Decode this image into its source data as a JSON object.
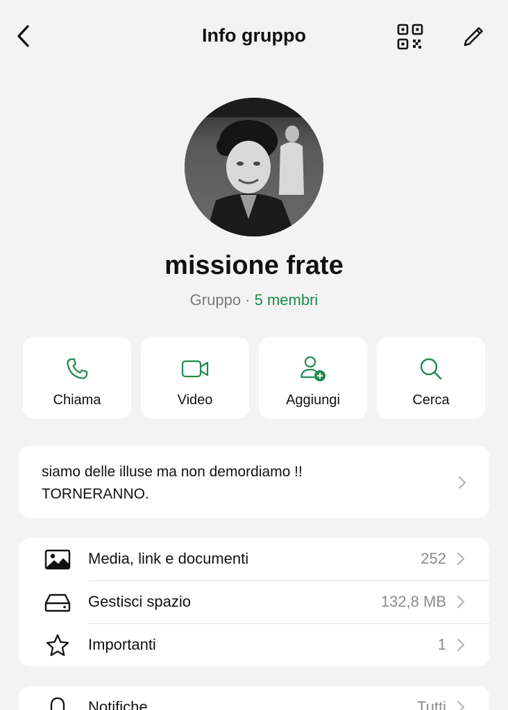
{
  "status": {
    "fragment": "‹ Indietro"
  },
  "header": {
    "title": "Info gruppo"
  },
  "group": {
    "name": "missione frate",
    "type_label": "Gruppo",
    "separator": " · ",
    "members_label": "5 membri"
  },
  "actions": [
    {
      "label": "Chiama",
      "icon": "phone-icon"
    },
    {
      "label": "Video",
      "icon": "video-camera-icon"
    },
    {
      "label": "Aggiungi",
      "icon": "add-person-icon"
    },
    {
      "label": "Cerca",
      "icon": "search-icon"
    }
  ],
  "description": {
    "line1": "siamo delle illuse ma non demordiamo !!",
    "line2": "TORNERANNO."
  },
  "list": [
    {
      "label": "Media, link e documenti",
      "value": "252",
      "icon": "photo-icon"
    },
    {
      "label": "Gestisci spazio",
      "value": "132,8 MB",
      "icon": "storage-drive-icon"
    },
    {
      "label": "Importanti",
      "value": "1",
      "icon": "star-icon"
    }
  ],
  "list2": [
    {
      "label": "Notifiche",
      "value": "Tutti",
      "icon": "bell-icon"
    }
  ],
  "colors": {
    "accent_green": "#1f8a4c",
    "background": "#f3f3f3",
    "card": "#ffffff"
  }
}
